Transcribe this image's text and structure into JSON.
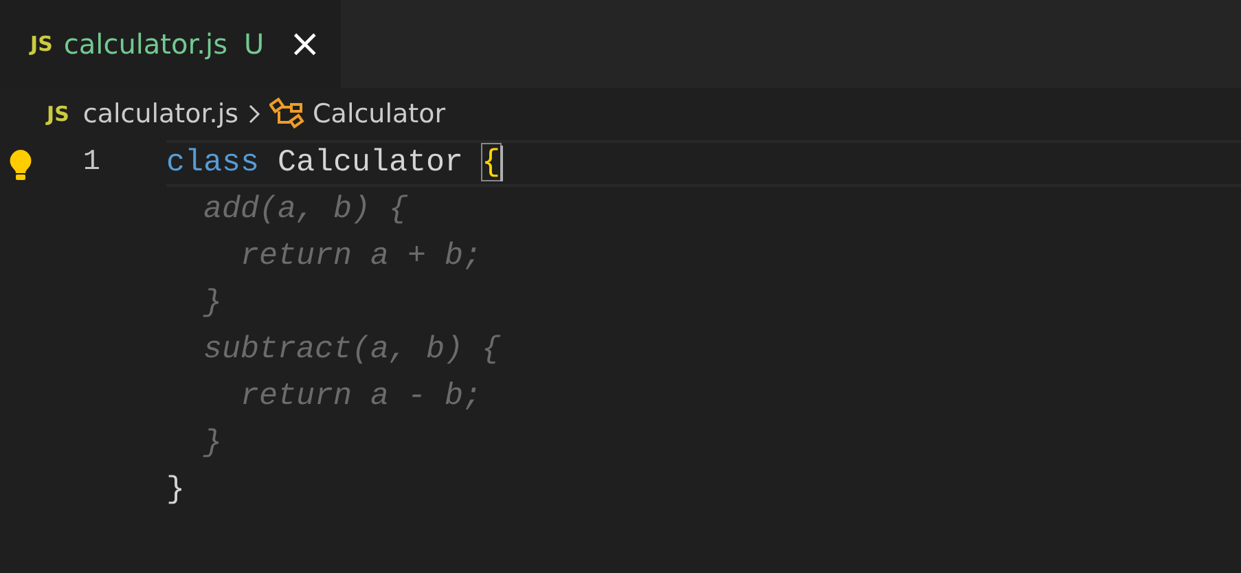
{
  "tabs": [
    {
      "file_type": "JS",
      "label": "calculator.js",
      "git_status": "U",
      "selected": true,
      "close": "×"
    }
  ],
  "breadcrumb": [
    {
      "kind": "file",
      "file_type": "JS",
      "label": "calculator.js"
    },
    {
      "kind": "class",
      "label": "Calculator"
    }
  ],
  "editor": {
    "lines": [
      {
        "number": "1",
        "lightbulb": true,
        "current": true,
        "kind": "code",
        "tokens": [
          {
            "kind": "keyword",
            "text": "class"
          },
          {
            "kind": "plain",
            "text": " Calculator "
          },
          {
            "kind": "bracket",
            "text": "{",
            "matched": true
          }
        ]
      },
      {
        "kind": "ghost",
        "text": "  add(a, b) {"
      },
      {
        "kind": "ghost",
        "text": "    return a + b;"
      },
      {
        "kind": "ghost",
        "text": "  }"
      },
      {
        "kind": "ghost",
        "text": "  subtract(a, b) {"
      },
      {
        "kind": "ghost",
        "text": "    return a - b;"
      },
      {
        "kind": "ghost",
        "text": "  }"
      },
      {
        "kind": "code",
        "tokens": [
          {
            "kind": "plain",
            "text": "}"
          }
        ]
      }
    ]
  }
}
